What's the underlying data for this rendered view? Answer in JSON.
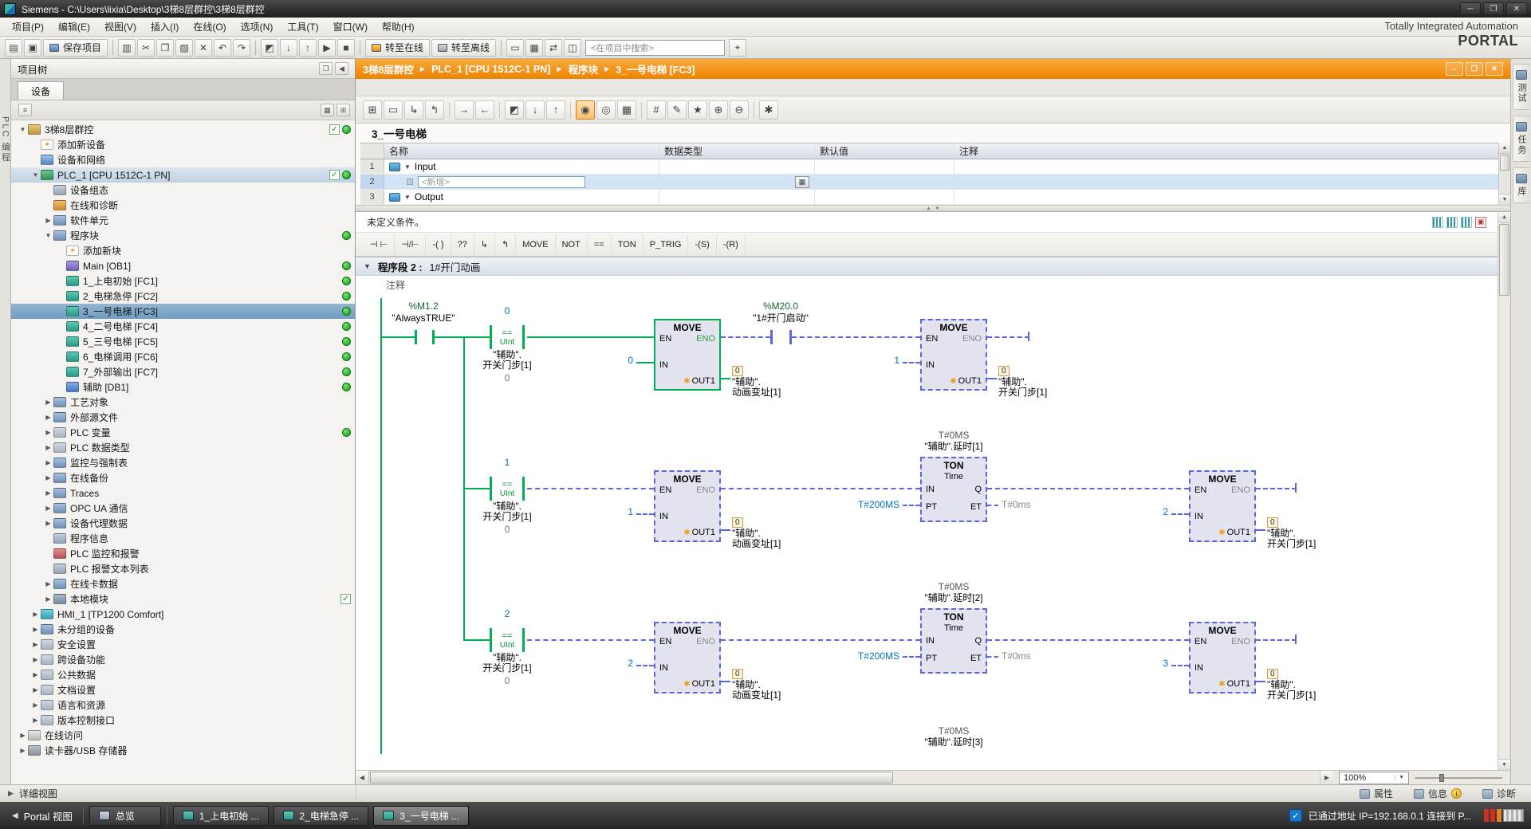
{
  "win": {
    "min": "─",
    "max": "❐",
    "close": "✕"
  },
  "titlebar": {
    "title": "Siemens  -  C:\\Users\\lixia\\Desktop\\3梯8层群控\\3梯8层群控"
  },
  "menubar": [
    "项目(P)",
    "编辑(E)",
    "视图(V)",
    "插入(I)",
    "在线(O)",
    "选项(N)",
    "工具(T)",
    "窗口(W)",
    "帮助(H)"
  ],
  "toolbar": {
    "icons_a": [
      {
        "name": "new-project-icon",
        "glyph": "▤"
      },
      {
        "name": "open-project-icon",
        "glyph": "▣"
      }
    ],
    "save": "保存项目",
    "icons_b": [
      {
        "name": "print-icon",
        "glyph": "▥"
      },
      {
        "name": "cut-icon",
        "glyph": "✂"
      },
      {
        "name": "copy-icon",
        "glyph": "❐"
      },
      {
        "name": "paste-icon",
        "glyph": "▨"
      },
      {
        "name": "delete-icon",
        "glyph": "✕"
      },
      {
        "name": "undo-icon",
        "glyph": "↶"
      },
      {
        "name": "redo-icon",
        "glyph": "↷"
      }
    ],
    "icons_c": [
      {
        "name": "compile-icon",
        "glyph": "◩"
      },
      {
        "name": "download-icon",
        "glyph": "↓"
      },
      {
        "name": "upload-icon",
        "glyph": "↑"
      },
      {
        "name": "start-cpu-icon",
        "glyph": "▶"
      },
      {
        "name": "stop-cpu-icon",
        "glyph": "■"
      }
    ],
    "go_online": "转至在线",
    "go_offline": "转至离线",
    "icons_d": [
      {
        "name": "accessible-devices-icon",
        "glyph": "▭"
      },
      {
        "name": "simulation-icon",
        "glyph": "▦"
      },
      {
        "name": "cross-reference-icon",
        "glyph": "⇄"
      },
      {
        "name": "split-editor-icon",
        "glyph": "◫"
      }
    ],
    "search_placeholder": "<在项目中搜索>",
    "icons_e": [
      {
        "name": "global-search-icon",
        "glyph": "⌖"
      }
    ]
  },
  "branding": {
    "line1": "Totally Integrated Automation",
    "line2": "PORTAL"
  },
  "left_strip": {
    "label": "PLC 编程"
  },
  "sidebar": {
    "title": "项目树",
    "header_icons": [
      {
        "name": "float-panel-icon",
        "glyph": "❐"
      },
      {
        "name": "collapse-panel-icon",
        "glyph": "◀"
      }
    ],
    "tab": "设备",
    "tool_icons": [
      {
        "name": "column-settings-icon",
        "glyph": "▦"
      },
      {
        "name": "expand-all-icon",
        "glyph": "⊞"
      }
    ],
    "items": [
      {
        "label": "3梯8层群控",
        "ind": "0",
        "arrow": "down",
        "icon": "project",
        "b1": "check",
        "b2": "dot"
      },
      {
        "label": "添加新设备",
        "ind": "1",
        "icon": "add"
      },
      {
        "label": "设备和网络",
        "ind": "1",
        "icon": "network"
      },
      {
        "label": "PLC_1 [CPU 1512C-1 PN]",
        "ind": "1",
        "arrow": "down",
        "icon": "plc",
        "b1": "check",
        "b2": "dot",
        "hl": "soft"
      },
      {
        "label": "设备组态",
        "ind": "2",
        "icon": "config"
      },
      {
        "label": "在线和诊断",
        "ind": "2",
        "icon": "diag"
      },
      {
        "label": "软件单元",
        "ind": "2",
        "arrow": "right",
        "icon": "folder"
      },
      {
        "label": "程序块",
        "ind": "2",
        "arrow": "down",
        "icon": "folder",
        "b2": "dot"
      },
      {
        "label": "添加新块",
        "ind": "3",
        "icon": "add"
      },
      {
        "label": "Main [OB1]",
        "ind": "3",
        "icon": "ob",
        "b2": "dot"
      },
      {
        "label": "1_上电初始 [FC1]",
        "ind": "3",
        "icon": "fc",
        "b2": "dot"
      },
      {
        "label": "2_电梯急停 [FC2]",
        "ind": "3",
        "icon": "fc",
        "b2": "dot"
      },
      {
        "label": "3_一号电梯 [FC3]",
        "ind": "3",
        "icon": "fc",
        "b2": "dot",
        "hl": "strong"
      },
      {
        "label": "4_二号电梯 [FC4]",
        "ind": "3",
        "icon": "fc",
        "b2": "dot"
      },
      {
        "label": "5_三号电梯 [FC5]",
        "ind": "3",
        "icon": "fc",
        "b2": "dot"
      },
      {
        "label": "6_电梯调用 [FC6]",
        "ind": "3",
        "icon": "fc",
        "b2": "dot"
      },
      {
        "label": "7_外部输出 [FC7]",
        "ind": "3",
        "icon": "fc",
        "b2": "dot"
      },
      {
        "label": "辅助 [DB1]",
        "ind": "3",
        "icon": "db",
        "b2": "dot"
      },
      {
        "label": "工艺对象",
        "ind": "2",
        "arrow": "right",
        "icon": "folder"
      },
      {
        "label": "外部源文件",
        "ind": "2",
        "arrow": "right",
        "icon": "folder"
      },
      {
        "label": "PLC 变量",
        "ind": "2",
        "arrow": "right",
        "icon": "tags",
        "b2": "dot"
      },
      {
        "label": "PLC 数据类型",
        "ind": "2",
        "arrow": "right",
        "icon": "datatype"
      },
      {
        "label": "监控与强制表",
        "ind": "2",
        "arrow": "right",
        "icon": "folder"
      },
      {
        "label": "在线备份",
        "ind": "2",
        "arrow": "right",
        "icon": "folder"
      },
      {
        "label": "Traces",
        "ind": "2",
        "arrow": "right",
        "icon": "folder"
      },
      {
        "label": "OPC UA 通信",
        "ind": "2",
        "arrow": "right",
        "icon": "folder"
      },
      {
        "label": "设备代理数据",
        "ind": "2",
        "arrow": "right",
        "icon": "folder"
      },
      {
        "label": "程序信息",
        "ind": "2",
        "icon": "info"
      },
      {
        "label": "PLC 监控和报警",
        "ind": "2",
        "icon": "alarm"
      },
      {
        "label": "PLC 报警文本列表",
        "ind": "2",
        "icon": "textlist"
      },
      {
        "label": "在线卡数据",
        "ind": "2",
        "arrow": "right",
        "icon": "folder"
      },
      {
        "label": "本地模块",
        "ind": "2",
        "arrow": "right",
        "icon": "module",
        "b1": "check"
      },
      {
        "label": "HMI_1 [TP1200 Comfort]",
        "ind": "1",
        "arrow": "right",
        "icon": "hmi"
      },
      {
        "label": "未分组的设备",
        "ind": "1",
        "arrow": "right",
        "icon": "folder"
      },
      {
        "label": "安全设置",
        "ind": "1",
        "arrow": "right",
        "icon": "security"
      },
      {
        "label": "跨设备功能",
        "ind": "1",
        "arrow": "right",
        "icon": "cross"
      },
      {
        "label": "公共数据",
        "ind": "1",
        "arrow": "right",
        "icon": "common"
      },
      {
        "label": "文档设置",
        "ind": "1",
        "arrow": "right",
        "icon": "docs"
      },
      {
        "label": "语言和资源",
        "ind": "1",
        "arrow": "right",
        "icon": "lang"
      },
      {
        "label": "版本控制接口",
        "ind": "1",
        "arrow": "right",
        "icon": "version"
      },
      {
        "label": "在线访问",
        "ind": "0",
        "arrow": "right",
        "icon": "online"
      },
      {
        "label": "读卡器/USB 存储器",
        "ind": "0",
        "arrow": "right",
        "icon": "usb"
      }
    ]
  },
  "editor": {
    "breadcrumb": [
      "3梯8层群控",
      "PLC_1 [CPU 1512C-1 PN]",
      "程序块",
      "3_一号电梯 [FC3]"
    ],
    "toolbar": [
      {
        "name": "insert-network-icon",
        "glyph": "⊞"
      },
      {
        "name": "add-empty-box-icon",
        "glyph": "▭"
      },
      {
        "name": "open-branch-icon",
        "glyph": "↳"
      },
      {
        "name": "close-branch-icon",
        "glyph": "↰"
      },
      {
        "sep": "1"
      },
      {
        "name": "goto-next-icon",
        "glyph": "→"
      },
      {
        "name": "goto-prev-icon",
        "glyph": "←"
      },
      {
        "sep": "1"
      },
      {
        "name": "compile-block-icon",
        "glyph": "◩"
      },
      {
        "name": "download-block-icon",
        "glyph": "↓"
      },
      {
        "name": "upload-block-icon",
        "glyph": "↑"
      },
      {
        "sep": "1"
      },
      {
        "name": "monitoring-on-icon",
        "glyph": "◉",
        "active": "true"
      },
      {
        "name": "monitoring-off-icon",
        "glyph": "◎"
      },
      {
        "name": "snapshot-icon",
        "glyph": "▦"
      },
      {
        "sep": "1"
      },
      {
        "name": "absolute-operands-icon",
        "glyph": "#"
      },
      {
        "name": "comments-icon",
        "glyph": "✎"
      },
      {
        "name": "favorites-icon",
        "glyph": "★"
      },
      {
        "name": "expand-networks-icon",
        "glyph": "⊕"
      },
      {
        "name": "collapse-networks-icon",
        "glyph": "⊖"
      },
      {
        "sep": "1"
      },
      {
        "name": "settings-icon",
        "glyph": "✱"
      }
    ],
    "block_title": "3_一号电梯",
    "headers": {
      "name": "名称",
      "type": "数据类型",
      "default": "默认值",
      "comment": "注释"
    },
    "rows": [
      {
        "num": "1",
        "label": "Input"
      },
      {
        "num": "2",
        "label": "<新增>"
      },
      {
        "num": "3",
        "label": "Output"
      }
    ],
    "condition": "未定义条件。",
    "lad_tools": [
      {
        "name": "no-contact-tool",
        "glyph": "⊣ ⊢"
      },
      {
        "name": "nc-contact-tool",
        "glyph": "⊣/⊢"
      },
      {
        "name": "coil-tool",
        "glyph": "-( )"
      },
      {
        "name": "empty-box-tool",
        "glyph": "??"
      },
      {
        "name": "open-branch-tool",
        "glyph": "↳"
      },
      {
        "name": "close-branch-tool",
        "glyph": "↰"
      },
      {
        "name": "move-tool",
        "glyph": "MOVE"
      },
      {
        "name": "not-tool",
        "glyph": "NOT"
      },
      {
        "name": "compare-tool",
        "glyph": "=="
      },
      {
        "name": "ton-tool",
        "glyph": "TON"
      },
      {
        "name": "ptrig-tool",
        "glyph": "P_TRIG"
      },
      {
        "name": "set-coil-tool",
        "glyph": "-(S)"
      },
      {
        "name": "reset-coil-tool",
        "glyph": "-(R)"
      }
    ],
    "network": {
      "label": "程序段 2 :",
      "title": "1#开门动画",
      "comment": "注释"
    },
    "zoom": "100%"
  },
  "ladder": {
    "r1": {
      "c1_addr": "%M1.2",
      "c1_name": "\"AlwaysTRUE\"",
      "cmp": {
        "val": "0",
        "op": "==",
        "type": "UInt",
        "op1": "\"辅助\".",
        "op2": "开关门步[1]",
        "cur": "0"
      },
      "ma": {
        "title": "MOVE",
        "en": "EN",
        "eno": "ENO",
        "in": "IN",
        "out": "OUT1",
        "in_val": "0",
        "d_val": "0",
        "d1": "\"辅助\".",
        "d2": "动画变址[1]"
      },
      "c2_addr": "%M20.0",
      "c2_name": "\"1#开门启动\"",
      "mb": {
        "title": "MOVE",
        "en": "EN",
        "eno": "ENO",
        "in": "IN",
        "out": "OUT1",
        "in_val": "1",
        "d_val": "0",
        "d1": "\"辅助\".",
        "d2": "开关门步[1]"
      }
    },
    "r2": {
      "cmp": {
        "val": "1",
        "op": "==",
        "type": "UInt",
        "op1": "\"辅助\".",
        "op2": "开关门步[1]",
        "cur": "0"
      },
      "ma": {
        "title": "MOVE",
        "en": "EN",
        "eno": "ENO",
        "in": "IN",
        "out": "OUT1",
        "in_val": "1",
        "d_val": "0",
        "d1": "\"辅助\".",
        "d2": "动画变址[1]"
      },
      "ton": {
        "pre_val": "T#0MS",
        "pre_name": "\"辅助\".延时[1]",
        "title": "TON",
        "type": "Time",
        "in": "IN",
        "q": "Q",
        "pt": "PT",
        "et": "ET",
        "pt_val": "T#200MS",
        "et_val": "T#0ms"
      },
      "mb": {
        "title": "MOVE",
        "en": "EN",
        "eno": "ENO",
        "in": "IN",
        "out": "OUT1",
        "in_val": "2",
        "d_val": "0",
        "d1": "\"辅助\".",
        "d2": "开关门步[1]"
      }
    },
    "r3": {
      "cmp": {
        "val": "2",
        "op": "==",
        "type": "UInt",
        "op1": "\"辅助\".",
        "op2": "开关门步[1]",
        "cur": "0"
      },
      "ma": {
        "title": "MOVE",
        "en": "EN",
        "eno": "ENO",
        "in": "IN",
        "out": "OUT1",
        "in_val": "2",
        "d_val": "0",
        "d1": "\"辅助\".",
        "d2": "动画变址[1]"
      },
      "ton": {
        "pre_val": "T#0MS",
        "pre_name": "\"辅助\".延时[2]",
        "title": "TON",
        "type": "Time",
        "in": "IN",
        "q": "Q",
        "pt": "PT",
        "et": "ET",
        "pt_val": "T#200MS",
        "et_val": "T#0ms"
      },
      "mb": {
        "title": "MOVE",
        "en": "EN",
        "eno": "ENO",
        "in": "IN",
        "out": "OUT1",
        "in_val": "3",
        "d_val": "0",
        "d1": "\"辅助\".",
        "d2": "开关门步[1]"
      }
    },
    "r4": {
      "pre_val": "T#0MS",
      "pre_name": "\"辅助\".延时[3]"
    }
  },
  "right_strip": [
    {
      "name": "tab-testing",
      "label": "测试"
    },
    {
      "name": "tab-tasks",
      "label": "任务"
    },
    {
      "name": "tab-libraries",
      "label": "库"
    }
  ],
  "bottom": {
    "detail_view": "详细视图",
    "tabs": [
      {
        "name": "tab-properties",
        "label": "属性"
      },
      {
        "name": "tab-info",
        "label": "信息",
        "badge": "i"
      },
      {
        "name": "tab-diagnostics",
        "label": "诊断"
      }
    ]
  },
  "taskbar": {
    "portal": "Portal 视图",
    "overview": "总览",
    "buttons": [
      {
        "label": "1_上电初始 ..."
      },
      {
        "label": "2_电梯急停 ..."
      },
      {
        "label": "3_一号电梯 ...",
        "active": "true"
      }
    ],
    "status": "已通过地址 IP=192.168.0.1 连接到 P..."
  }
}
